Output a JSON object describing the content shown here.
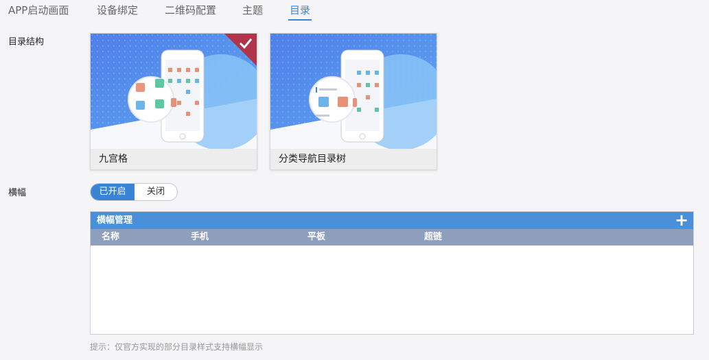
{
  "tabs": [
    {
      "label": "APP启动画面"
    },
    {
      "label": "设备绑定"
    },
    {
      "label": "二维码配置"
    },
    {
      "label": "主题"
    },
    {
      "label": "目录",
      "active": true
    }
  ],
  "directory": {
    "label": "目录结构",
    "options": [
      {
        "label": "九宫格",
        "selected": true
      },
      {
        "label": "分类导航目录树",
        "selected": false
      }
    ]
  },
  "banner": {
    "label": "横幅",
    "toggle": {
      "on_label": "已开启",
      "off_label": "关闭",
      "state": "on"
    }
  },
  "banner_panel": {
    "title": "横幅管理",
    "add_icon": "plus-icon",
    "columns": [
      "名称",
      "手机",
      "平板",
      "超链"
    ],
    "rows": []
  },
  "hint": "提示：仅官方实现的部分目录样式支持横幅显示",
  "colors": {
    "accent": "#3a84d6",
    "panel_header": "#4a90d9",
    "columns_bg": "#8e9fbc",
    "selected_badge": "#b0354a"
  }
}
